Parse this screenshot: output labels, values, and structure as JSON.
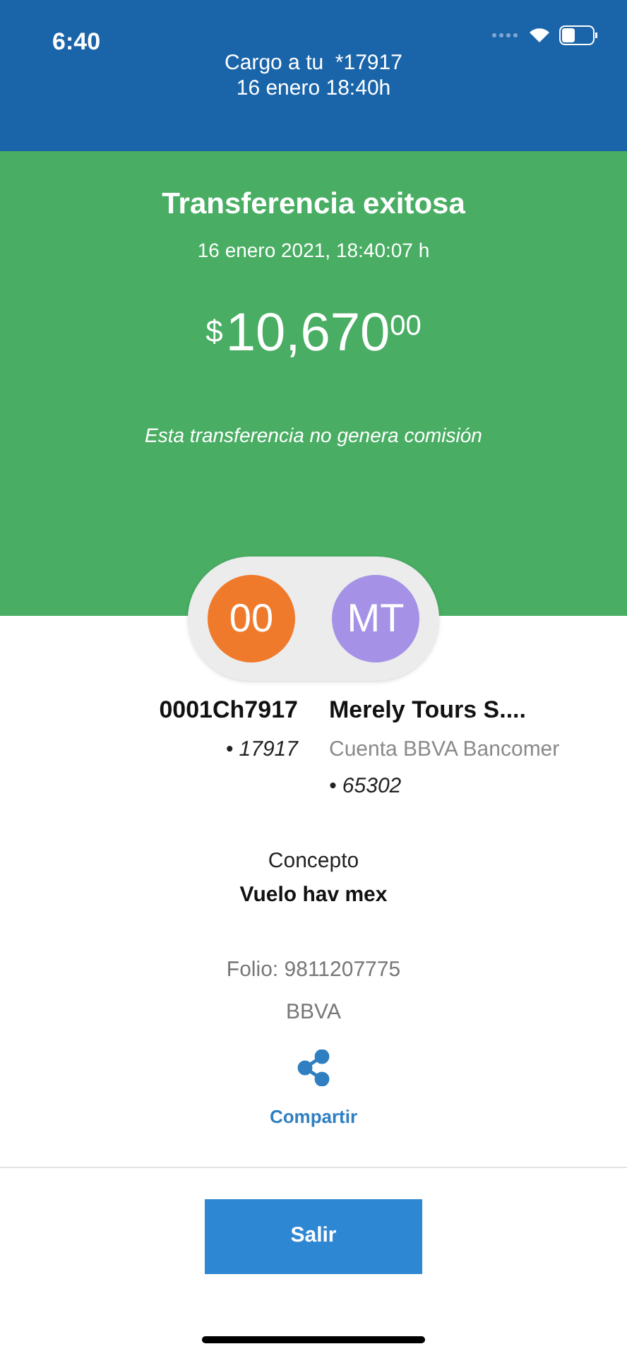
{
  "status_bar": {
    "time": "6:40"
  },
  "header": {
    "line_1": "Cargo a tu  *17917",
    "line_2": "16 enero 18:40h"
  },
  "summary": {
    "title": "Transferencia exitosa",
    "datetime": "16 enero 2021, 18:40:07 h",
    "currency": "$",
    "amount": "10,670",
    "cents": "00",
    "note": "Esta transferencia no genera comisión"
  },
  "parties": [
    {
      "initials": "00",
      "color": "#f07a2c",
      "name": "0001Ch7917",
      "lines": [
        {
          "text": "• 17917",
          "kind": "account"
        }
      ]
    },
    {
      "initials": "MT",
      "color": "#a592e6",
      "name": "Merely Tours S....",
      "lines": [
        {
          "text": "Cuenta BBVA Bancomer",
          "kind": "bank"
        },
        {
          "text": "• 65302",
          "kind": "account"
        }
      ]
    }
  ],
  "concept": {
    "label": "Concepto",
    "value": "Vuelo hav mex"
  },
  "folio": "Folio: 9811207775",
  "bank": "BBVA",
  "share": {
    "label": "Compartir"
  },
  "exit_button": {
    "label": "Salir"
  }
}
